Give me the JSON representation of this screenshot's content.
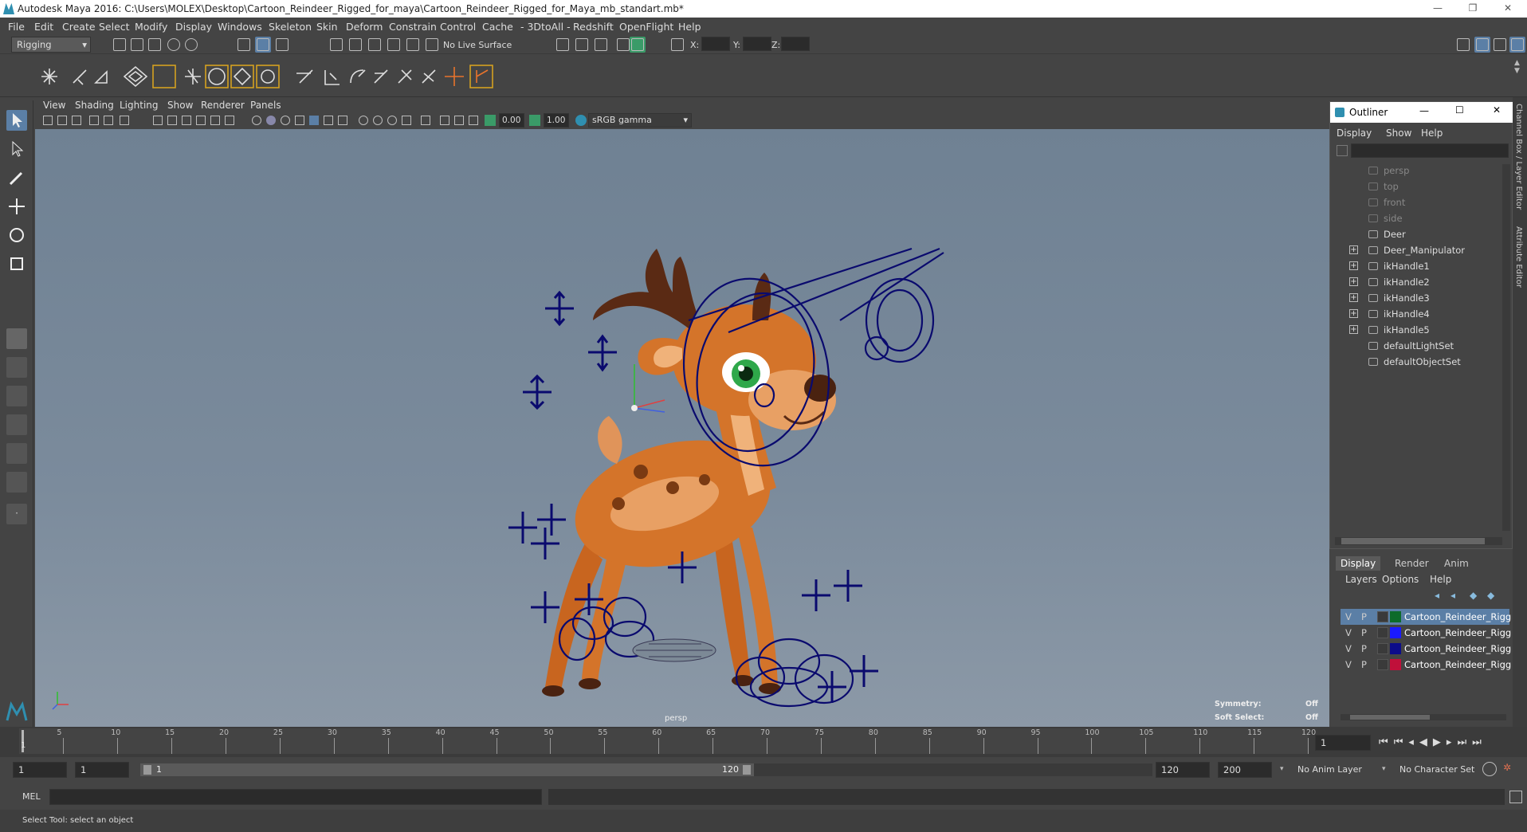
{
  "window": {
    "title": "Autodesk Maya 2016: C:\\Users\\MOLEX\\Desktop\\Cartoon_Reindeer_Rigged_for_maya\\Cartoon_Reindeer_Rigged_for_Maya_mb_standart.mb*"
  },
  "menubar": [
    "File",
    "Edit",
    "Create",
    "Select",
    "Modify",
    "Display",
    "Windows",
    "Skeleton",
    "Skin",
    "Deform",
    "Constrain",
    "Control",
    "Cache",
    "- 3DtoAll -",
    "Redshift",
    "OpenFlight",
    "Help"
  ],
  "status": {
    "mode": "Rigging",
    "live_surface": "No Live Surface",
    "x_label": "X:",
    "y_label": "Y:",
    "z_label": "Z:"
  },
  "viewport_menu": [
    "View",
    "Shading",
    "Lighting",
    "Show",
    "Renderer",
    "Panels"
  ],
  "viewport_toolbar": {
    "near": "0.00",
    "far": "1.00",
    "color_space": "sRGB gamma"
  },
  "viewport": {
    "camera": "persp",
    "symmetry_label": "Symmetry:",
    "symmetry_value": "Off",
    "softselect_label": "Soft Select:",
    "softselect_value": "Off"
  },
  "outliner": {
    "title": "Outliner",
    "menu": [
      "Display",
      "Show",
      "Help"
    ],
    "items": [
      {
        "label": "persp",
        "dim": true,
        "expandable": false
      },
      {
        "label": "top",
        "dim": true,
        "expandable": false
      },
      {
        "label": "front",
        "dim": true,
        "expandable": false
      },
      {
        "label": "side",
        "dim": true,
        "expandable": false
      },
      {
        "label": "Deer",
        "dim": false,
        "expandable": false
      },
      {
        "label": "Deer_Manipulator",
        "dim": false,
        "expandable": true
      },
      {
        "label": "ikHandle1",
        "dim": false,
        "expandable": true
      },
      {
        "label": "ikHandle2",
        "dim": false,
        "expandable": true
      },
      {
        "label": "ikHandle3",
        "dim": false,
        "expandable": true
      },
      {
        "label": "ikHandle4",
        "dim": false,
        "expandable": true
      },
      {
        "label": "ikHandle5",
        "dim": false,
        "expandable": true
      },
      {
        "label": "defaultLightSet",
        "dim": false,
        "expandable": false
      },
      {
        "label": "defaultObjectSet",
        "dim": false,
        "expandable": false
      }
    ]
  },
  "layer_editor": {
    "tabs": [
      "Display",
      "Render",
      "Anim"
    ],
    "menu": [
      "Layers",
      "Options",
      "Help"
    ],
    "layers": [
      {
        "v": "V",
        "p": "P",
        "color": "#0d6b2a",
        "name": "Cartoon_Reindeer_Rigg",
        "selected": true
      },
      {
        "v": "V",
        "p": "P",
        "color": "#1a1aff",
        "name": "Cartoon_Reindeer_Rigg",
        "selected": false
      },
      {
        "v": "V",
        "p": "P",
        "color": "#0c0c8a",
        "name": "Cartoon_Reindeer_Rigg",
        "selected": false
      },
      {
        "v": "V",
        "p": "P",
        "color": "#c0103a",
        "name": "Cartoon_Reindeer_Rigg",
        "selected": false
      }
    ]
  },
  "side_tabs": {
    "channel_box": "Channel Box / Layer Editor",
    "attribute_editor": "Attribute Editor"
  },
  "timeline": {
    "ticks": [
      "5",
      "10",
      "15",
      "20",
      "25",
      "30",
      "35",
      "40",
      "45",
      "50",
      "55",
      "60",
      "65",
      "70",
      "75",
      "80",
      "85",
      "90",
      "95",
      "100",
      "105",
      "110",
      "115",
      "120"
    ],
    "start_tick": "1",
    "current_frame": "1"
  },
  "range": {
    "start": "1",
    "anim_start": "1",
    "slider_start": "1",
    "slider_end": "120",
    "end": "120",
    "anim_end": "200",
    "anim_layer": "No Anim Layer",
    "char_set": "No Character Set"
  },
  "command": {
    "label": "MEL"
  },
  "help": {
    "text": "Select Tool: select an object"
  },
  "colors": {
    "rig": "#0a0a6e",
    "body": "#d4742a",
    "antler": "#5a2a14",
    "accent": "#2f8fb0"
  }
}
